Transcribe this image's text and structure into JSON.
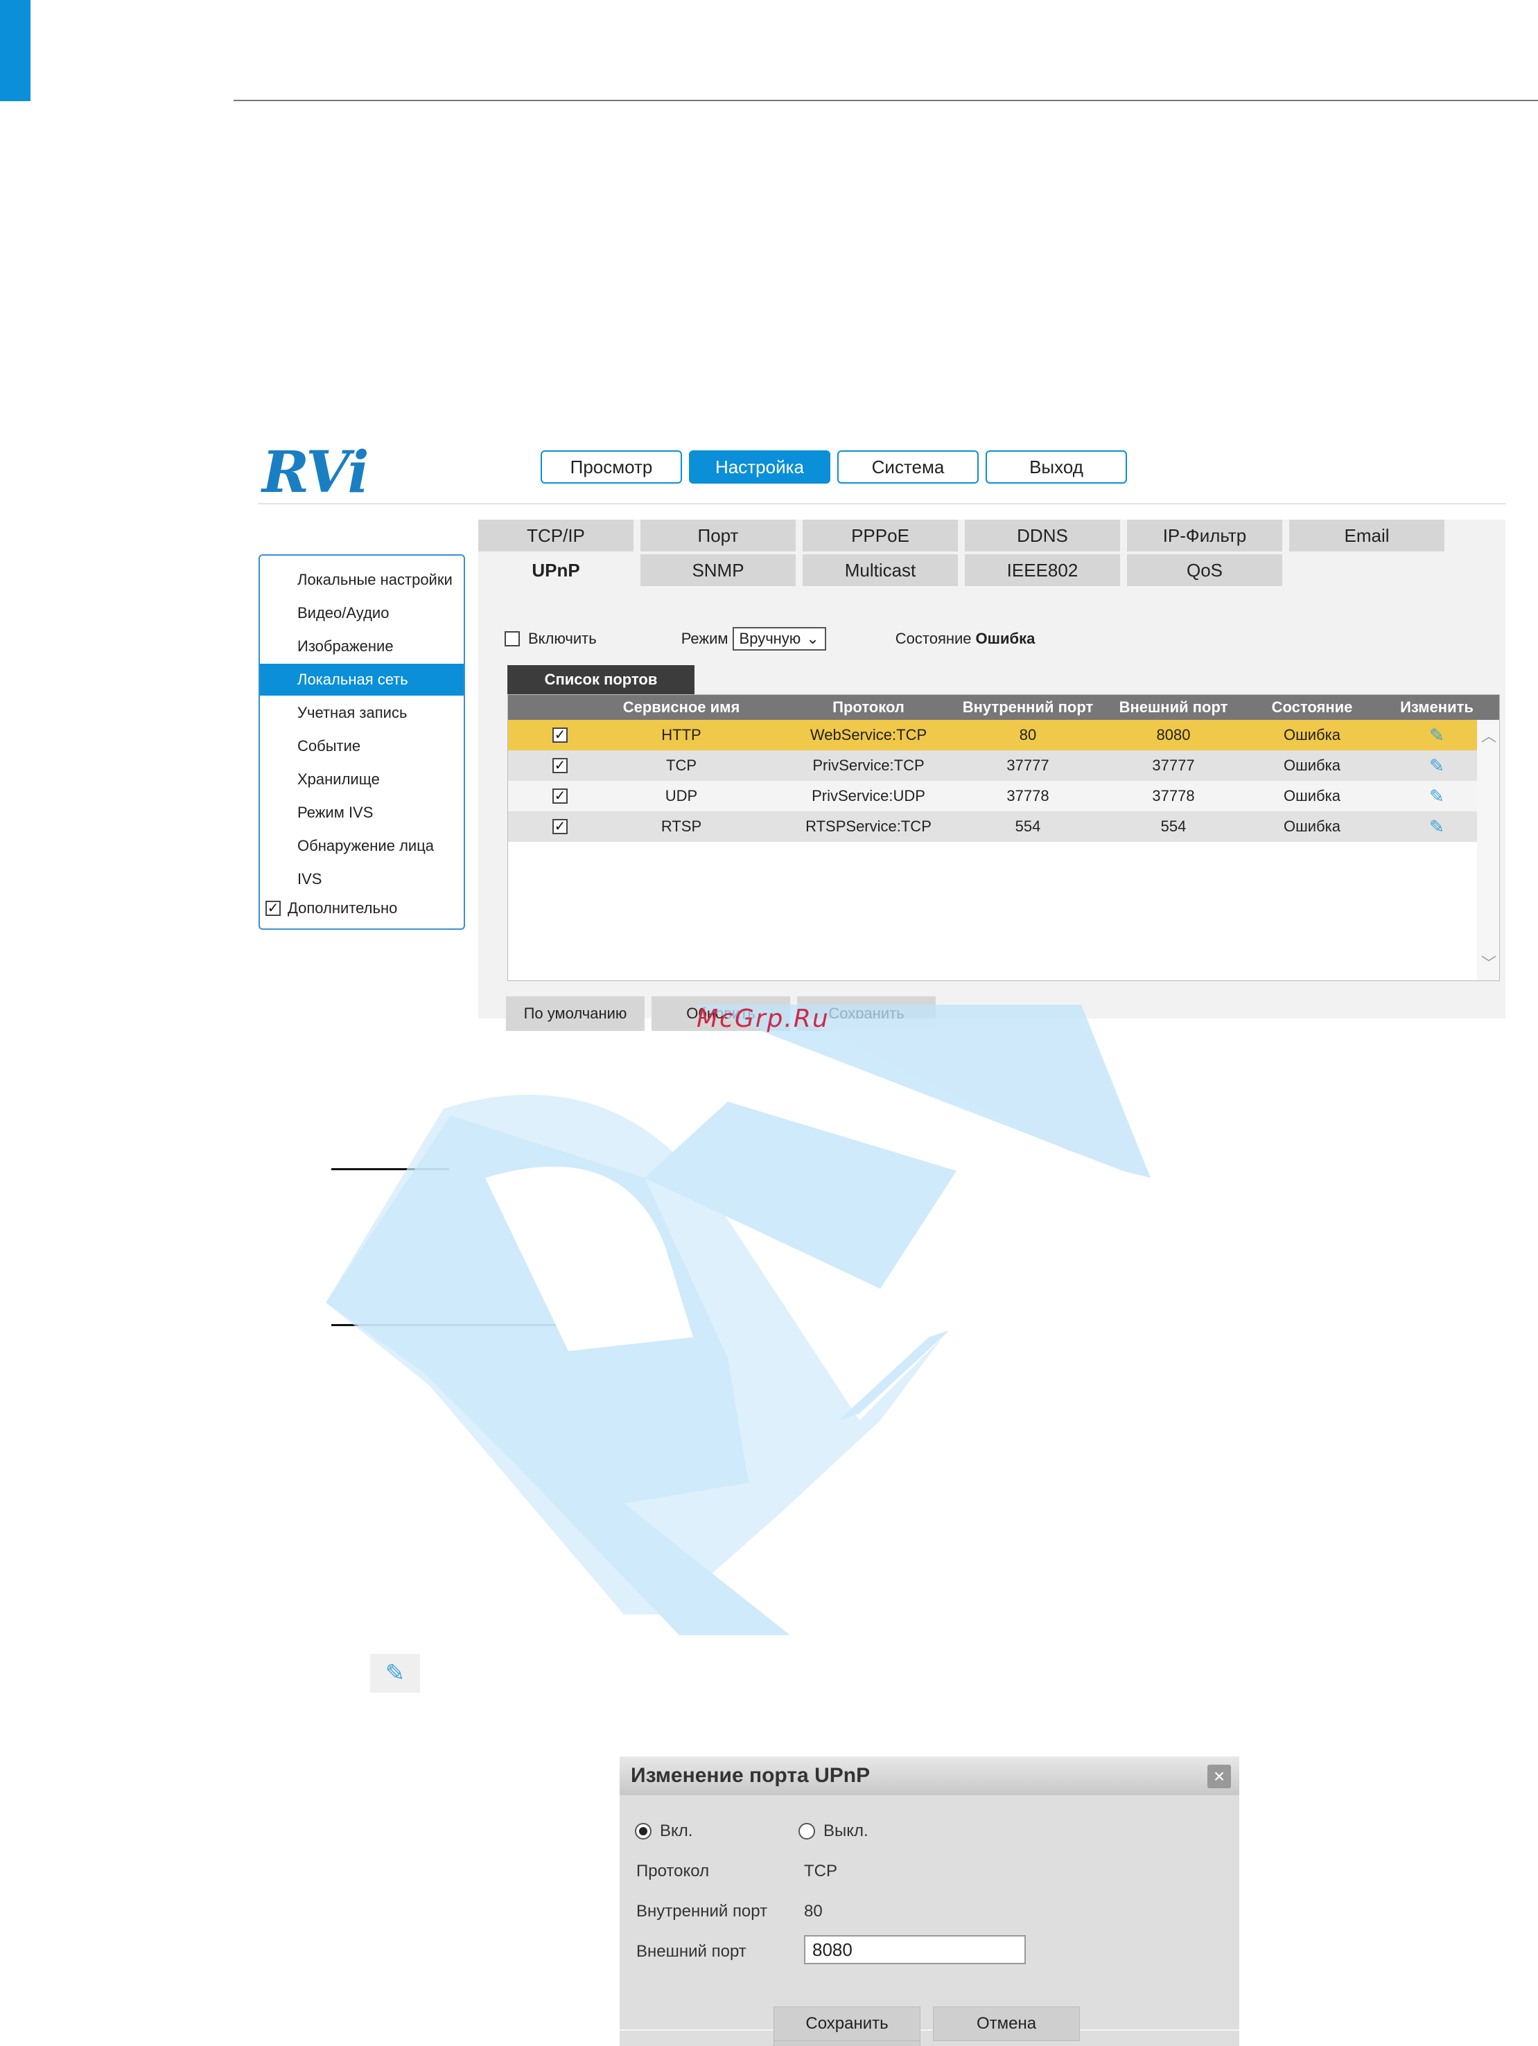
{
  "colors": {
    "accent": "#0a8fd8",
    "highlight_row": "#f0c84a",
    "watermark": "#cfe9fa",
    "watermark_text": "#d0284a"
  },
  "watermark": {
    "text": "McGrp.Ru",
    "logo_icon": "rvi-watermark-logo"
  },
  "app": {
    "logo": "RVi",
    "topnav": [
      "Просмотр",
      "Настройка",
      "Система",
      "Выход"
    ],
    "topnav_active": "Настройка",
    "sidebar": {
      "items": [
        "Локальные настройки",
        "Видео/Аудио",
        "Изображение",
        "Локальная сеть",
        "Учетная запись",
        "Событие",
        "Хранилище",
        "Режим IVS",
        "Обнаружение лица",
        "IVS"
      ],
      "active": "Локальная сеть",
      "extra": "Дополнительно"
    },
    "tabs_row1": [
      "TCP/IP",
      "Порт",
      "PPPoE",
      "DDNS",
      "IP-Фильтр",
      "Email"
    ],
    "tabs_row2": [
      "UPnP",
      "SNMP",
      "Multicast",
      "IEEE802",
      "QoS"
    ],
    "active_tab": "UPnP",
    "options": {
      "enable_label": "Включить",
      "mode_label": "Режим",
      "mode_value": "Вручную",
      "status_label": "Состояние",
      "status_value": "Ошибка"
    },
    "port_list_tab": "Список портов",
    "table": {
      "headers": [
        "Сервисное имя",
        "Протокол",
        "Внутренний порт",
        "Внешний порт",
        "Состояние",
        "Изменить"
      ],
      "rows": [
        {
          "name": "HTTP",
          "protocol": "WebService:TCP",
          "internal": "80",
          "external": "8080",
          "state": "Ошибка"
        },
        {
          "name": "TCP",
          "protocol": "PrivService:TCP",
          "internal": "37777",
          "external": "37777",
          "state": "Ошибка"
        },
        {
          "name": "UDP",
          "protocol": "PrivService:UDP",
          "internal": "37778",
          "external": "37778",
          "state": "Ошибка"
        },
        {
          "name": "RTSP",
          "protocol": "RTSPService:TCP",
          "internal": "554",
          "external": "554",
          "state": "Ошибка"
        }
      ]
    },
    "buttons": [
      "По умолчанию",
      "Обновить",
      "Сохранить"
    ]
  },
  "dialog": {
    "title": "Изменение порта UPnP",
    "on_label": "Вкл.",
    "off_label": "Выкл.",
    "protocol_label": "Протокол",
    "protocol_value": "TCP",
    "internal_label": "Внутренний порт",
    "internal_value": "80",
    "external_label": "Внешний порт",
    "external_value": "8080",
    "save": "Сохранить",
    "cancel": "Отмена"
  }
}
